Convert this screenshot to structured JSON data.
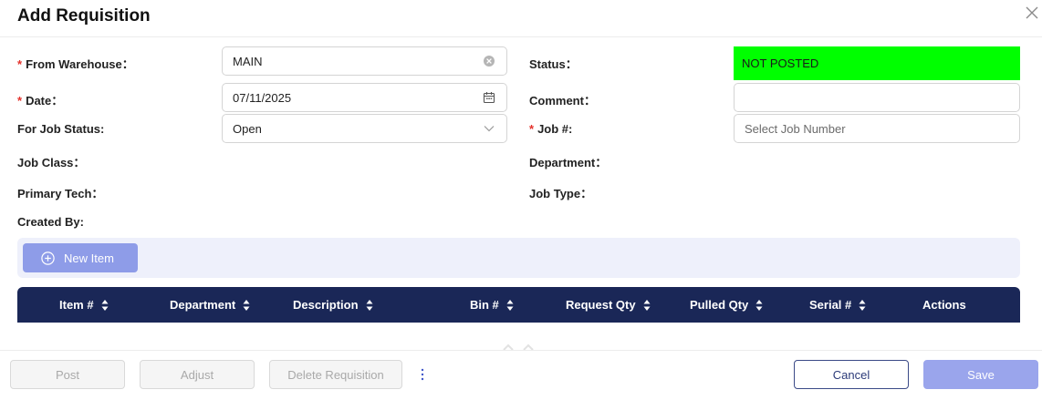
{
  "dialog": {
    "title": "Add Requisition"
  },
  "form": {
    "from_warehouse": {
      "label": "From Warehouse：",
      "value": "MAIN"
    },
    "date": {
      "label": "Date：",
      "value": "07/11/2025"
    },
    "for_job_status": {
      "label": "For Job Status:",
      "value": "Open"
    },
    "job_class": {
      "label": "Job Class："
    },
    "primary_tech": {
      "label": "Primary Tech："
    },
    "created_by": {
      "label": "Created By:"
    },
    "status": {
      "label": "Status：",
      "value": "NOT POSTED",
      "color": "#00ff00"
    },
    "comment": {
      "label": "Comment：",
      "value": ""
    },
    "job_number": {
      "label": "Job #:",
      "placeholder": "Select Job Number"
    },
    "department": {
      "label": "Department："
    },
    "job_type": {
      "label": "Job Type："
    },
    "required_marker": "*"
  },
  "toolbar": {
    "new_item_label": "New Item"
  },
  "table": {
    "columns": [
      {
        "label": "Item #",
        "sortable": true
      },
      {
        "label": "Department",
        "sortable": true
      },
      {
        "label": "Description",
        "sortable": true
      },
      {
        "label": "Bin #",
        "sortable": true
      },
      {
        "label": "Request Qty",
        "sortable": true
      },
      {
        "label": "Pulled Qty",
        "sortable": true
      },
      {
        "label": "Serial #",
        "sortable": true
      },
      {
        "label": "Actions",
        "sortable": false
      }
    ],
    "header_color": "#1a2757"
  },
  "footer": {
    "post_label": "Post",
    "adjust_label": "Adjust",
    "delete_label": "Delete Requisition",
    "cancel_label": "Cancel",
    "save_label": "Save"
  },
  "icons": {
    "close": "close-icon",
    "clear": "clear-icon",
    "calendar": "calendar-icon",
    "chevron": "chevron-down-icon",
    "add": "plus-circle-icon",
    "sort": "sort-icon",
    "more": "more-vertical-icon"
  }
}
